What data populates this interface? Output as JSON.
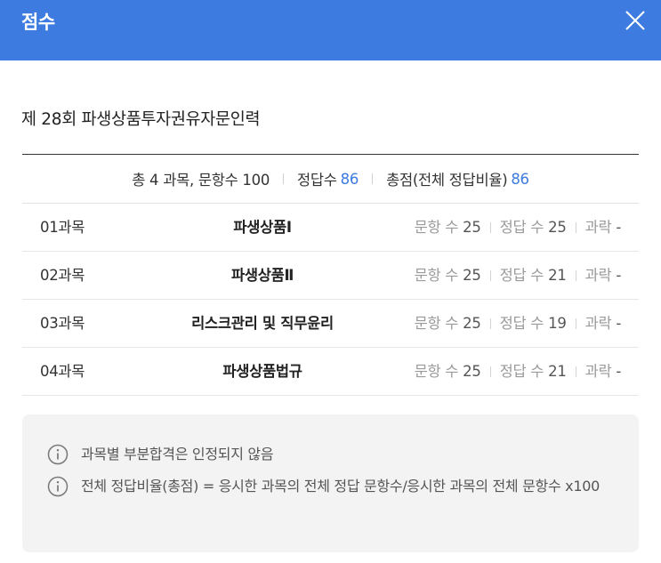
{
  "header": {
    "title": "점수"
  },
  "exam": {
    "title": "제 28회 파생상품투자권유자문인력"
  },
  "summary": {
    "totals": "총 4 과목, 문항수 100",
    "correct_label": "정답수",
    "correct_value": "86",
    "score_label": "총점(전체 정답비율)",
    "score_value": "86"
  },
  "labels": {
    "questions": "문항 수",
    "correct": "정답 수",
    "fail": "과락"
  },
  "subjects": [
    {
      "code": "01과목",
      "name": "파생상품Ⅰ",
      "questions": "25",
      "correct": "25",
      "fail": "-"
    },
    {
      "code": "02과목",
      "name": "파생상품Ⅱ",
      "questions": "25",
      "correct": "21",
      "fail": "-"
    },
    {
      "code": "03과목",
      "name": "리스크관리 및 직무윤리",
      "questions": "25",
      "correct": "19",
      "fail": "-"
    },
    {
      "code": "04과목",
      "name": "파생상품법규",
      "questions": "25",
      "correct": "21",
      "fail": "-"
    }
  ],
  "notices": [
    "과목별 부분합격은 인정되지 않음",
    "전체 정답비율(총점) = 응시한 과목의 전체 정답 문항수/응시한 과목의 전체 문항수 x100"
  ],
  "colors": {
    "header": "#3d7be0",
    "accent": "#3d7be0"
  },
  "icons": {
    "close": "close-icon",
    "info": "info-icon"
  }
}
